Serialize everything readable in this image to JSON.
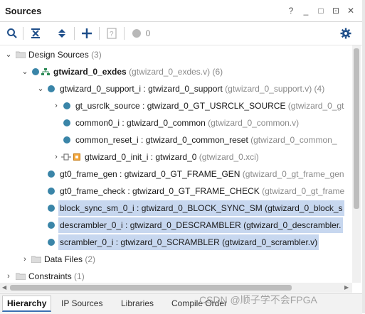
{
  "panel": {
    "title": "Sources"
  },
  "window_buttons": [
    "?",
    "_",
    "□",
    "⊡",
    "✕"
  ],
  "toolbar": {
    "count": "0"
  },
  "tree": [
    {
      "name": "design-sources",
      "label": "Design Sources",
      "suffix": "(3)",
      "expanded": true,
      "folder": true
    },
    {
      "name": "gtwizard-exdes",
      "label": "gtwizard_0_exdes",
      "suffix": "(gtwizard_0_exdes.v) (6)",
      "expanded": true,
      "bold": true
    },
    {
      "name": "support-i",
      "label": "gtwizard_0_support_i : gtwizard_0_support",
      "suffix": "(gtwizard_0_support.v) (4)",
      "expanded": true
    },
    {
      "name": "gt-usrclk-source",
      "label": "gt_usrclk_source : gtwizard_0_GT_USRCLK_SOURCE",
      "suffix": "(gtwizard_0_gt",
      "expanded": false
    },
    {
      "name": "common0-i",
      "label": "common0_i : gtwizard_0_common",
      "suffix": "(gtwizard_0_common.v)"
    },
    {
      "name": "common-reset-i",
      "label": "common_reset_i : gtwizard_0_common_reset",
      "suffix": "(gtwizard_0_common_"
    },
    {
      "name": "init-i",
      "label": "gtwizard_0_init_i : gtwizard_0",
      "suffix": "(gtwizard_0.xci)",
      "expanded": false,
      "ip": true
    },
    {
      "name": "gt0-frame-gen",
      "label": "gt0_frame_gen : gtwizard_0_GT_FRAME_GEN",
      "suffix": "(gtwizard_0_gt_frame_gen"
    },
    {
      "name": "gt0-frame-check",
      "label": "gt0_frame_check : gtwizard_0_GT_FRAME_CHECK",
      "suffix": "(gtwizard_0_gt_frame"
    },
    {
      "name": "block-sync-sm",
      "label": "block_sync_sm_0_i : gtwizard_0_BLOCK_SYNC_SM (gtwizard_0_block_s",
      "suffix": "",
      "selected": true
    },
    {
      "name": "descrambler",
      "label": "descrambler_0_i : gtwizard_0_DESCRAMBLER (gtwizard_0_descrambler.",
      "suffix": "",
      "selected": true
    },
    {
      "name": "scrambler",
      "label": "scrambler_0_i : gtwizard_0_SCRAMBLER (gtwizard_0_scrambler.v)",
      "suffix": "",
      "selected": true
    },
    {
      "name": "data-files",
      "label": "Data Files",
      "suffix": "(2)",
      "expanded": false,
      "folder": true
    },
    {
      "name": "constraints",
      "label": "Constraints",
      "suffix": "(1)",
      "expanded": false,
      "folder": true
    }
  ],
  "tabs": [
    "Hierarchy",
    "IP Sources",
    "Libraries",
    "Compile Order"
  ],
  "watermark": "CSDN @顺子学不会FPGA"
}
